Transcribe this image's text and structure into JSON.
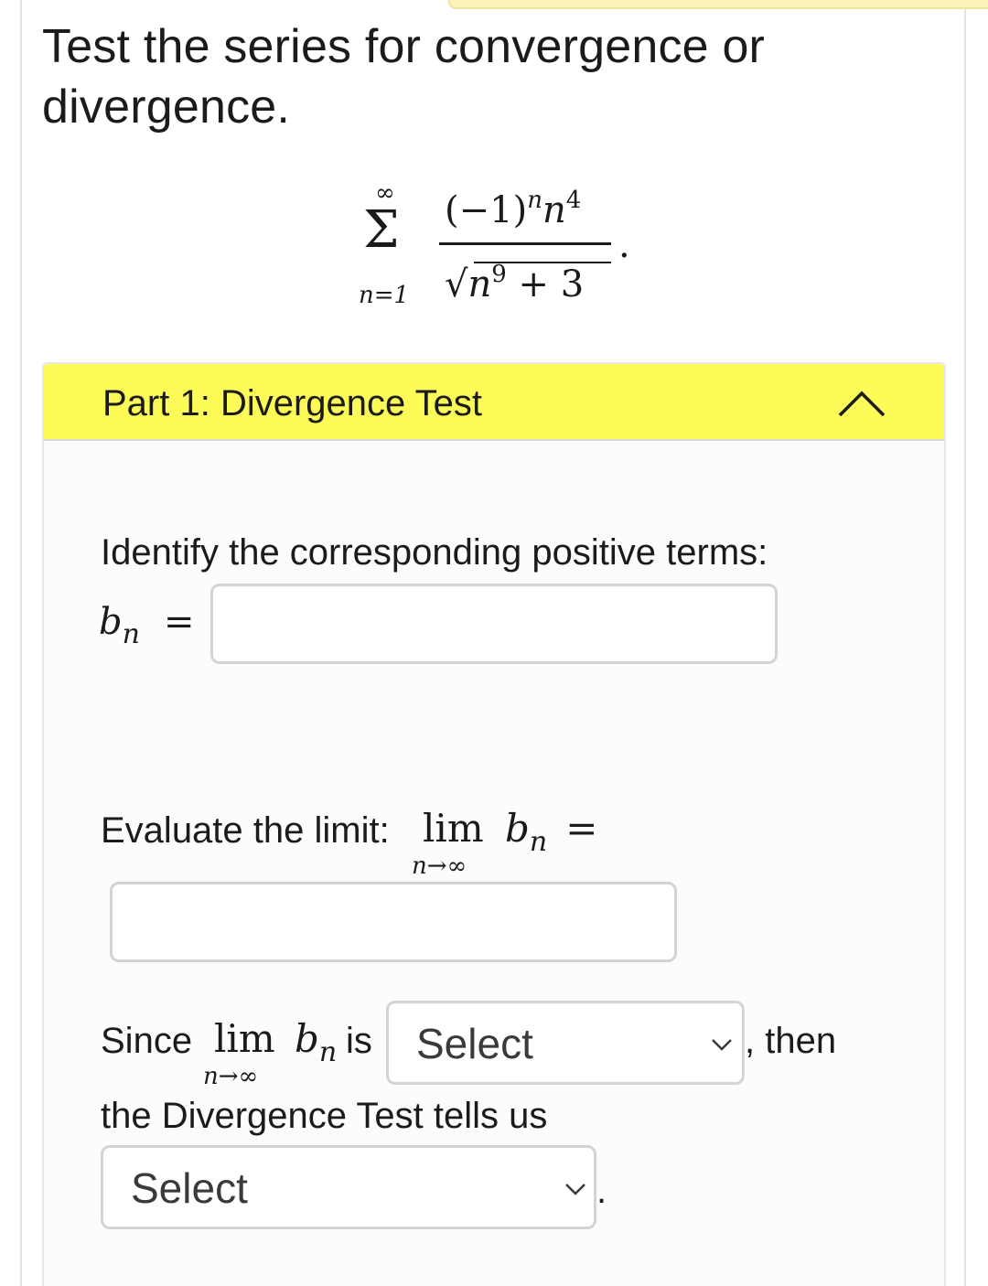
{
  "question": {
    "title": "Test the series for convergence or divergence."
  },
  "series": {
    "upper_limit": "∞",
    "sum_symbol": "Σ",
    "lower_limit": "n=1",
    "numerator_base": "(−1)",
    "numerator_exp1": "n",
    "numerator_var": "n",
    "numerator_exp2": "4",
    "denominator_sqrt": "√",
    "denominator_var": "n",
    "denominator_exp": "9",
    "denominator_rest": " + 3",
    "terminator": "."
  },
  "part1": {
    "title": "Part 1: Divergence Test",
    "toggle_icon": "chevron-up-icon",
    "identify_prompt": "Identify the corresponding positive terms:",
    "bn_symbol": "b",
    "bn_subscript": "n",
    "equals": "=",
    "bn_input": {
      "value": "",
      "placeholder": ""
    },
    "evaluate_prompt": "Evaluate the limit:",
    "lim_word": "lim",
    "lim_under": "n→∞",
    "limit_input": {
      "value": "",
      "placeholder": ""
    },
    "since_word": "Since",
    "is_word": "is",
    "select1": {
      "selected": "Select"
    },
    "then_text": ", then",
    "conclusion_text": "the Divergence Test tells us",
    "select2": {
      "selected": "Select"
    },
    "final_period": "."
  },
  "colors": {
    "header_highlight": "#fdfb57",
    "top_strip": "#fdf2b8",
    "input_border": "#d4d4d4"
  }
}
